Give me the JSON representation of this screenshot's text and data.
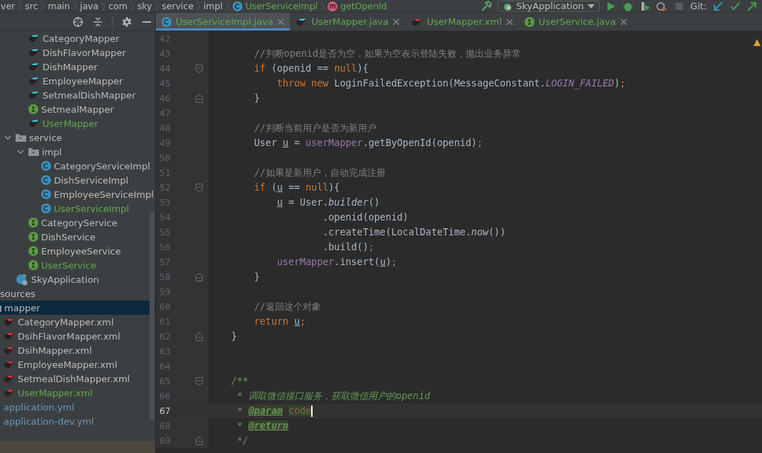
{
  "breadcrumb": [
    {
      "label": "ver"
    },
    {
      "label": "src"
    },
    {
      "label": "main"
    },
    {
      "label": "java"
    },
    {
      "label": "com"
    },
    {
      "label": "sky"
    },
    {
      "label": "service"
    },
    {
      "label": "impl"
    },
    {
      "label": "UserServiceImpl",
      "kind": "class"
    },
    {
      "label": "getOpenId",
      "kind": "method"
    }
  ],
  "run_config": {
    "label": "SkyApplication"
  },
  "vcs": {
    "label": "Git:"
  },
  "tabs": [
    {
      "label": "UserServiceImpl.java",
      "kind": "class",
      "selected": true
    },
    {
      "label": "UserMapper.java",
      "kind": "mapper",
      "selected": false
    },
    {
      "label": "UserMapper.xml",
      "kind": "xml",
      "selected": false
    },
    {
      "label": "UserService.java",
      "kind": "interface",
      "selected": false
    }
  ],
  "tree": [
    {
      "children": [
        {
          "label": "CategoryMapper",
          "kind": "mapper"
        },
        {
          "label": "DishFlavorMapper",
          "kind": "mapper"
        },
        {
          "label": "DishMapper",
          "kind": "mapper"
        },
        {
          "label": "EmployeeMapper",
          "kind": "mapper"
        },
        {
          "label": "SetmealDishMapper",
          "kind": "mapper"
        },
        {
          "label": "SetmealMapper",
          "kind": "interface"
        },
        {
          "label": "UserMapper",
          "kind": "mapper",
          "color": "#62a851"
        }
      ]
    },
    {
      "label": "service",
      "kind": "package",
      "expanded": true,
      "children": [
        {
          "label": "impl",
          "kind": "package",
          "expanded": true,
          "children": [
            {
              "label": "CategoryServiceImpl",
              "kind": "class"
            },
            {
              "label": "DishServiceImpl",
              "kind": "class"
            },
            {
              "label": "EmployeeServiceImpl",
              "kind": "class"
            },
            {
              "label": "UserServiceImpl",
              "kind": "class",
              "color": "#62a851"
            }
          ]
        },
        {
          "label": "CategoryService",
          "kind": "interface"
        },
        {
          "label": "DishService",
          "kind": "interface"
        },
        {
          "label": "EmployeeService",
          "kind": "interface"
        },
        {
          "label": "UserService",
          "kind": "interface",
          "color": "#62a851"
        }
      ]
    },
    {
      "label": "SkyApplication",
      "kind": "app"
    }
  ],
  "tree_lower": [
    {
      "label": "sources",
      "children": [
        {
          "label": "mapper",
          "kind": "package",
          "selected": true,
          "children": [
            {
              "label": "CategoryMapper.xml",
              "kind": "xml"
            },
            {
              "label": "DsihFlavorMapper.xml",
              "kind": "xml"
            },
            {
              "label": "DsihMapper.xml",
              "kind": "xml"
            },
            {
              "label": "EmployeeMapper.xml",
              "kind": "xml"
            },
            {
              "label": "SetmealDishMapper.xml",
              "kind": "xml"
            },
            {
              "label": "UserMapper.xml",
              "kind": "xml",
              "color": "#62a851"
            }
          ]
        },
        {
          "label": "application.yml",
          "kind": "yml",
          "color": "#6897bb"
        },
        {
          "label": "application-dev.yml",
          "kind": "yml",
          "color": "#6897bb"
        }
      ]
    }
  ],
  "code_lines": [
    {
      "number": "42",
      "current": false
    },
    {
      "number": "43",
      "current": false,
      "tokens": [
        {
          "kind": "comment",
          "t": "        //判断openid是否为空，如果为空表示登陆失败，抛出业务异常"
        }
      ]
    },
    {
      "number": "44",
      "current": false,
      "marker": {
        "kind": "open"
      },
      "tokens": [
        {
          "kind": "kw",
          "t": "        if"
        },
        {
          "kind": "plain",
          "t": " (openid == "
        },
        {
          "kind": "kw",
          "t": "null"
        },
        {
          "kind": "plain",
          "t": "){"
        }
      ]
    },
    {
      "number": "45",
      "current": false,
      "tokens": [
        {
          "kind": "kw",
          "t": "            throw new"
        },
        {
          "kind": "plain",
          "t": " LoginFailedException(MessageConstant."
        },
        {
          "kind": "static",
          "t": "LOGIN_FAILED"
        },
        {
          "kind": "plain",
          "t": ")"
        },
        {
          "kind": "kw",
          "t": ";"
        }
      ]
    },
    {
      "number": "46",
      "current": false,
      "marker": {
        "kind": "close"
      },
      "tokens": [
        {
          "kind": "plain",
          "t": "        }"
        }
      ]
    },
    {
      "number": "47",
      "current": false
    },
    {
      "number": "48",
      "current": false,
      "tokens": [
        {
          "kind": "comment",
          "t": "        //判断当前用户是否为新用户"
        }
      ]
    },
    {
      "number": "49",
      "current": false,
      "tokens": [
        {
          "kind": "plain",
          "t": "        User "
        },
        {
          "kind": "var",
          "t": "u"
        },
        {
          "kind": "plain",
          "t": " = "
        },
        {
          "kind": "field",
          "t": "userMapper"
        },
        {
          "kind": "plain",
          "t": ".getByOpenId(openid)"
        },
        {
          "kind": "kw",
          "t": ";"
        }
      ]
    },
    {
      "number": "50",
      "current": false
    },
    {
      "number": "51",
      "current": false,
      "tokens": [
        {
          "kind": "comment",
          "t": "        //如果是新用户，自动完成注册"
        }
      ]
    },
    {
      "number": "52",
      "current": false,
      "marker": {
        "kind": "open"
      },
      "tokens": [
        {
          "kind": "kw",
          "t": "        if"
        },
        {
          "kind": "plain",
          "t": " ("
        },
        {
          "kind": "var",
          "t": "u"
        },
        {
          "kind": "plain",
          "t": " == "
        },
        {
          "kind": "kw",
          "t": "null"
        },
        {
          "kind": "plain",
          "t": "){"
        }
      ]
    },
    {
      "number": "53",
      "current": false,
      "tokens": [
        {
          "kind": "var",
          "t": "            u"
        },
        {
          "kind": "plain",
          "t": " = User."
        },
        {
          "kind": "italic",
          "t": "builder"
        },
        {
          "kind": "plain",
          "t": "()"
        }
      ]
    },
    {
      "number": "54",
      "current": false,
      "tokens": [
        {
          "kind": "plain",
          "t": "                    .openid(openid)"
        }
      ]
    },
    {
      "number": "55",
      "current": false,
      "tokens": [
        {
          "kind": "plain",
          "t": "                    .createTime(LocalDateTime."
        },
        {
          "kind": "italic",
          "t": "now"
        },
        {
          "kind": "plain",
          "t": "())"
        }
      ]
    },
    {
      "number": "56",
      "current": false,
      "tokens": [
        {
          "kind": "plain",
          "t": "                    .build()"
        },
        {
          "kind": "kw",
          "t": ";"
        }
      ]
    },
    {
      "number": "57",
      "current": false,
      "tokens": [
        {
          "kind": "field",
          "t": "            userMapper"
        },
        {
          "kind": "plain",
          "t": ".insert("
        },
        {
          "kind": "var",
          "t": "u"
        },
        {
          "kind": "plain",
          "t": ")"
        },
        {
          "kind": "kw",
          "t": ";"
        }
      ]
    },
    {
      "number": "58",
      "current": false,
      "marker": {
        "kind": "close"
      },
      "tokens": [
        {
          "kind": "plain",
          "t": "        }"
        }
      ]
    },
    {
      "number": "59",
      "current": false
    },
    {
      "number": "60",
      "current": false,
      "tokens": [
        {
          "kind": "comment",
          "t": "        //返回这个对象"
        }
      ]
    },
    {
      "number": "61",
      "current": false,
      "tokens": [
        {
          "kind": "kw",
          "t": "        return "
        },
        {
          "kind": "var",
          "t": "u"
        },
        {
          "kind": "kw",
          "t": ";"
        }
      ]
    },
    {
      "number": "62",
      "current": false,
      "marker": {
        "kind": "close"
      },
      "tokens": [
        {
          "kind": "plain",
          "t": "    }"
        }
      ]
    },
    {
      "number": "63",
      "current": false
    },
    {
      "number": "64",
      "current": false
    },
    {
      "number": "65",
      "current": false,
      "marker": {
        "kind": "open"
      },
      "tokens": [
        {
          "kind": "doc",
          "t": "    /**"
        }
      ]
    },
    {
      "number": "66",
      "current": false,
      "tokens": [
        {
          "kind": "doc",
          "t": "     * 调取微信接口服务，获取微信用户的openid"
        }
      ]
    },
    {
      "number": "67",
      "current": true,
      "tokens": [
        {
          "kind": "doc",
          "t": "     * "
        },
        {
          "kind": "tag",
          "t": "@param "
        },
        {
          "kind": "param",
          "t": "code"
        }
      ]
    },
    {
      "number": "68",
      "current": false,
      "tokens": [
        {
          "kind": "doc",
          "t": "     * "
        },
        {
          "kind": "tag",
          "t": "@return"
        }
      ]
    },
    {
      "number": "69",
      "current": false,
      "marker": {
        "kind": "close"
      },
      "tokens": [
        {
          "kind": "doc",
          "t": "     */"
        }
      ]
    }
  ]
}
